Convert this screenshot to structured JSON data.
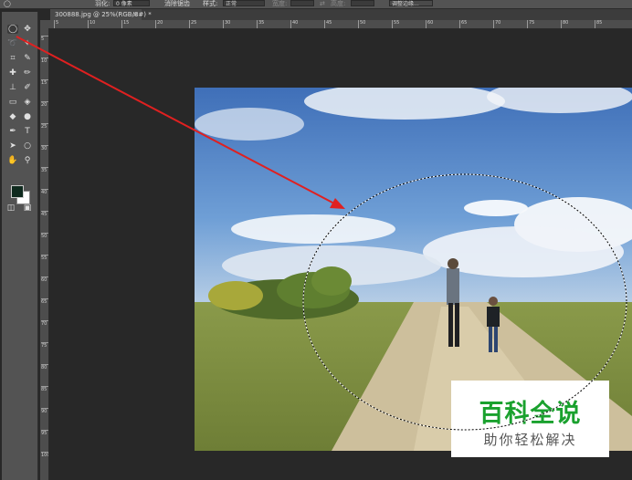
{
  "options_bar": {
    "feather_label": "羽化:",
    "feather_value": "0 像素",
    "antialias_label": "消除锯齿",
    "style_label": "样式:",
    "style_value": "正常",
    "width_label": "宽度:",
    "height_label": "高度:",
    "refine_edge_label": "调整边缘..."
  },
  "document_tab": {
    "title": "300888.jpg @ 25%(RGB/8#) *",
    "close": "×"
  },
  "ruler": {
    "horizontal_ticks": [
      "5",
      "10",
      "15",
      "20",
      "25",
      "30",
      "35",
      "40",
      "45",
      "50",
      "55",
      "60",
      "65",
      "70",
      "75",
      "80",
      "85"
    ],
    "vertical_ticks": [
      "5",
      "10",
      "15",
      "20",
      "25",
      "30",
      "35",
      "40",
      "45",
      "50",
      "55",
      "60",
      "65",
      "70",
      "75",
      "80",
      "85",
      "90",
      "95",
      "100"
    ]
  },
  "toolbox": {
    "tools": [
      {
        "name": "elliptical-marquee-icon",
        "glyph": "◯"
      },
      {
        "name": "move-icon",
        "glyph": "✥"
      },
      {
        "name": "lasso-icon",
        "glyph": "➰"
      },
      {
        "name": "magic-wand-icon",
        "glyph": "✦"
      },
      {
        "name": "crop-icon",
        "glyph": "⌗"
      },
      {
        "name": "eyedropper-icon",
        "glyph": "✎"
      },
      {
        "name": "healing-icon",
        "glyph": "✚"
      },
      {
        "name": "brush-icon",
        "glyph": "✏"
      },
      {
        "name": "stamp-icon",
        "glyph": "⊥"
      },
      {
        "name": "history-brush-icon",
        "glyph": "✐"
      },
      {
        "name": "eraser-icon",
        "glyph": "▭"
      },
      {
        "name": "bucket-icon",
        "glyph": "◈"
      },
      {
        "name": "blur-icon",
        "glyph": "◆"
      },
      {
        "name": "dodge-icon",
        "glyph": "●"
      },
      {
        "name": "pen-icon",
        "glyph": "✒"
      },
      {
        "name": "text-icon",
        "glyph": "T"
      },
      {
        "name": "path-select-icon",
        "glyph": "➤"
      },
      {
        "name": "shape-icon",
        "glyph": "○"
      },
      {
        "name": "hand-icon",
        "glyph": "✋"
      },
      {
        "name": "zoom-icon",
        "glyph": "⚲"
      }
    ]
  },
  "colors": {
    "foreground": "#0f2a1e",
    "background": "#ffffff",
    "arrow": "#e02020"
  },
  "watermark": {
    "main_text": "百科全说",
    "sub_text": "助你轻松解决"
  }
}
